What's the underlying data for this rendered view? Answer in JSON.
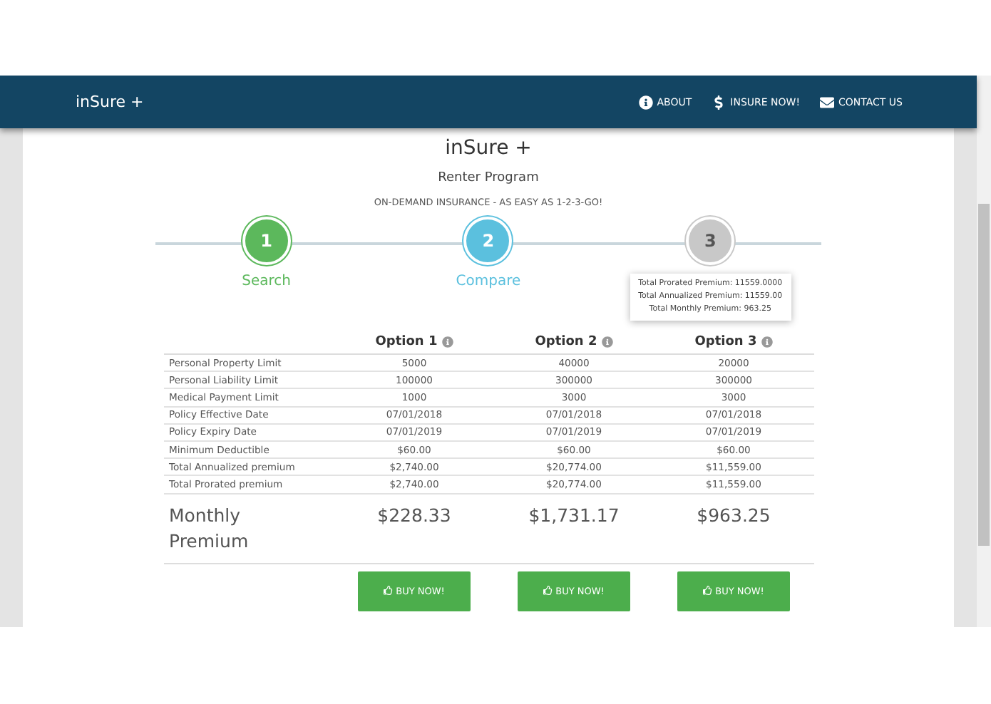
{
  "navbar": {
    "brand": "inSure +",
    "links": [
      {
        "kind": "info",
        "label": "ABOUT"
      },
      {
        "kind": "dollar",
        "label": "INSURE NOW!"
      },
      {
        "kind": "mail",
        "label": "CONTACT US"
      }
    ]
  },
  "header": {
    "title": "inSure +",
    "subtitle": "Renter Program",
    "tagline": "ON-DEMAND INSURANCE - AS EASY AS 1-2-3-GO!"
  },
  "steps": [
    {
      "number": "1",
      "label": "Search",
      "kind": "done"
    },
    {
      "number": "2",
      "label": "Compare",
      "kind": "current"
    },
    {
      "number": "3",
      "kind": "pending",
      "tooltip": [
        "Total Prorated Premium: 11559.0000",
        "Total Annualized Premium: 11559.00",
        "Total Monthly Premium: 963.25"
      ]
    }
  ],
  "table": {
    "columns": [
      "Option 1",
      "Option 2",
      "Option 3"
    ],
    "rows": [
      {
        "label": "Personal Property Limit",
        "values": [
          "5000",
          "40000",
          "20000"
        ]
      },
      {
        "label": "Personal Liability Limit",
        "values": [
          "100000",
          "300000",
          "300000"
        ]
      },
      {
        "label": "Medical Payment Limit",
        "values": [
          "1000",
          "3000",
          "3000"
        ]
      },
      {
        "label": "Policy Effective Date",
        "values": [
          "07/01/2018",
          "07/01/2018",
          "07/01/2018"
        ]
      },
      {
        "label": "Policy Expiry Date",
        "values": [
          "07/01/2019",
          "07/01/2019",
          "07/01/2019"
        ]
      },
      {
        "label": "Minimum Deductible",
        "values": [
          "$60.00",
          "$60.00",
          "$60.00"
        ]
      },
      {
        "label": "Total Annualized premium",
        "values": [
          "$2,740.00",
          "$20,774.00",
          "$11,559.00"
        ]
      },
      {
        "label": "Total Prorated premium",
        "values": [
          "$2,740.00",
          "$20,774.00",
          "$11,559.00"
        ]
      }
    ],
    "monthly": {
      "label": "Monthly Premium",
      "values": [
        "$228.33",
        "$1,731.17",
        "$963.25"
      ]
    },
    "buttons": [
      "BUY NOW!",
      "BUY NOW!",
      "BUY NOW!"
    ]
  }
}
